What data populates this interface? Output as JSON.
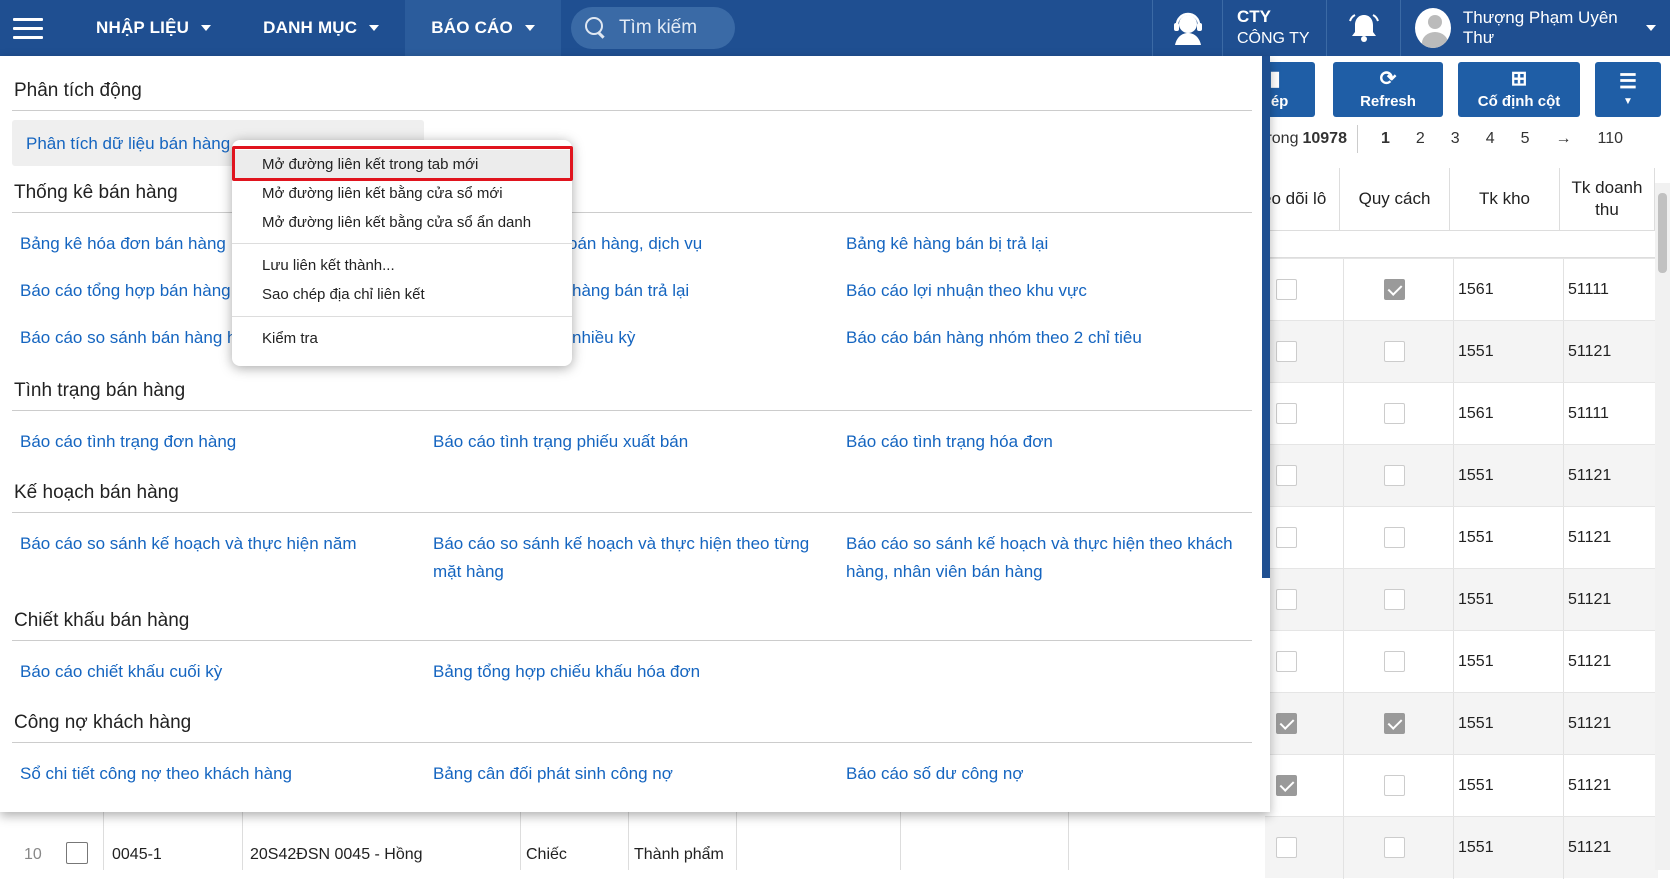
{
  "topbar": {
    "nav": [
      {
        "label": "NHẬP LIỆU"
      },
      {
        "label": "DANH MỤC"
      },
      {
        "label": "BÁO CÁO"
      }
    ],
    "search_placeholder": "Tìm kiếm",
    "company_line1": "CTY",
    "company_line2": "CÔNG TY",
    "user_name": "Thượng Phạm Uyên Thư"
  },
  "toolbar": {
    "copy_label": "hép",
    "refresh_label": "Refresh",
    "fix_column_label": "Cố định cột"
  },
  "pager": {
    "total_prefix": "trong",
    "total": "10978",
    "pages": [
      "1",
      "2",
      "3",
      "4",
      "5"
    ],
    "next": "→",
    "last": "110"
  },
  "grid": {
    "headers": [
      "eo dõi lô",
      "Quy cách",
      "Tk kho",
      "Tk doanh thu"
    ],
    "rows": [
      {
        "lot": false,
        "spec": true,
        "kho": "1561",
        "dt": "51111"
      },
      {
        "lot": false,
        "spec": false,
        "kho": "1551",
        "dt": "51121"
      },
      {
        "lot": false,
        "spec": false,
        "kho": "1561",
        "dt": "51111"
      },
      {
        "lot": false,
        "spec": false,
        "kho": "1551",
        "dt": "51121"
      },
      {
        "lot": false,
        "spec": false,
        "kho": "1551",
        "dt": "51121"
      },
      {
        "lot": false,
        "spec": false,
        "kho": "1551",
        "dt": "51121"
      },
      {
        "lot": false,
        "spec": false,
        "kho": "1551",
        "dt": "51121"
      },
      {
        "lot": true,
        "spec": true,
        "kho": "1551",
        "dt": "51121"
      },
      {
        "lot": true,
        "spec": false,
        "kho": "1551",
        "dt": "51121"
      },
      {
        "lot": false,
        "spec": false,
        "kho": "1551",
        "dt": "51121"
      }
    ],
    "bottom_row": {
      "index": "10",
      "code": "0045-1",
      "name": "20S42ĐSN 0045 - Hồng",
      "unit": "Chiếc",
      "type": "Thành phẩm"
    }
  },
  "menu": {
    "sections": [
      {
        "title": "Phân tích động",
        "links": [
          "Phân tích dữ liệu bán hàng"
        ]
      },
      {
        "title": "Thống kê bán hàng",
        "links": [
          "Bảng kê hóa đơn bán hàng",
          "oán hàng, dịch vụ",
          "Bảng kê hàng bán bị trả lại",
          "Báo cáo tổng hợp bán hàng",
          "hàng bán trả lại",
          "Báo cáo lợi nhuận theo khu vực",
          "Báo cáo so sánh bán hàng ha",
          "nhiều kỳ",
          "Báo cáo bán hàng nhóm theo 2 chỉ tiêu"
        ]
      },
      {
        "title": "Tình trạng bán hàng",
        "links": [
          "Báo cáo tình trạng đơn hàng",
          "Báo cáo tình trạng phiếu xuất bán",
          "Báo cáo tình trạng hóa đơn"
        ]
      },
      {
        "title": "Kế hoạch bán hàng",
        "links": [
          "Báo cáo so sánh kế hoạch và thực hiện năm",
          "Báo cáo so sánh kế hoạch và thực hiện theo từng mặt hàng",
          "Báo cáo so sánh kế hoạch và thực hiện theo khách hàng, nhân viên bán hàng"
        ]
      },
      {
        "title": "Chiết khấu bán hàng",
        "links": [
          "Báo cáo chiết khấu cuối kỳ",
          "Bảng tổng hợp chiếu khấu hóa đơn"
        ]
      },
      {
        "title": "Công nợ khách hàng",
        "links": [
          "Sổ chi tiết công nợ theo khách hàng",
          "Bảng cân đối phát sinh công nợ",
          "Báo cáo số dư công nợ"
        ]
      }
    ]
  },
  "context_menu": {
    "items": [
      "Mở đường liên kết trong tab mới",
      "Mở đường liên kết bằng cửa sổ mới",
      "Mở đường liên kết bằng cửa sổ ẩn danh",
      "Lưu liên kết thành...",
      "Sao chép địa chỉ liên kết",
      "Kiểm tra"
    ]
  }
}
